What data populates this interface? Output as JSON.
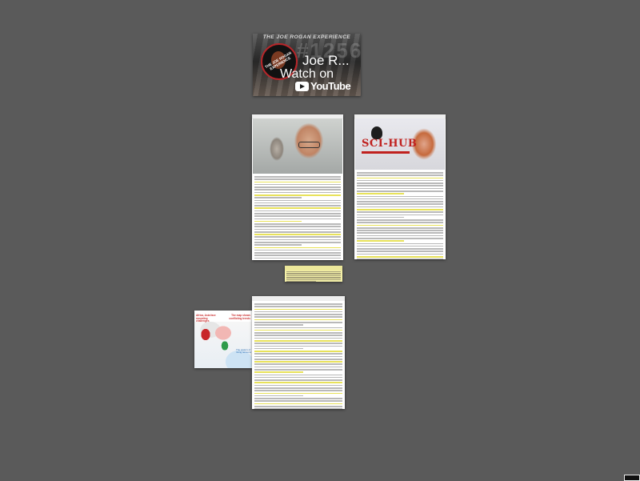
{
  "youtube": {
    "banner": "THE JOE ROGAN EXPERIENCE",
    "episode_number": "#1256",
    "logo_text": "THE JOE ROGAN EXPERIENCE",
    "title": "Joe R...",
    "watch_on": "Watch on",
    "brand": "YouTube"
  },
  "articles": [
    {
      "id": "a1",
      "lines": 46,
      "highlight_every": 5
    },
    {
      "id": "a2",
      "lines": 44,
      "highlight_every": 6
    },
    {
      "id": "a3",
      "lines": 58,
      "highlight_every": 4
    }
  ],
  "sci_hub_image": {
    "logo_text": "SCI-HUB"
  },
  "note": {
    "lines": 6
  },
  "map": {
    "left_caption": "Africa, Asia face mounting challenges",
    "right_caption": "The map shows conflicting trends",
    "sea_label": "The waters of rising tensions"
  },
  "colors": {
    "canvas": "#5a5a5a",
    "highlight": "#e8e25a",
    "note": "#f4f0a8",
    "youtube_red": "#c0211e"
  }
}
